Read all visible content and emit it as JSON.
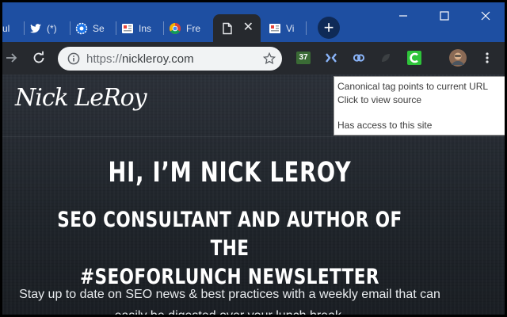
{
  "tabs": [
    {
      "title": "ul",
      "icon": "partial-tab-icon"
    },
    {
      "title": "(*)",
      "icon": "twitter-bird-icon"
    },
    {
      "title": "Se",
      "icon": "gear-badge-icon"
    },
    {
      "title": "Ins",
      "icon": "report-icon"
    },
    {
      "title": "Fre",
      "icon": "chrome-icon"
    },
    {
      "title": "",
      "icon": "document-icon",
      "active": true
    },
    {
      "title": "Vi",
      "icon": "report-icon"
    }
  ],
  "address": {
    "scheme": "https://",
    "host": "nickleroy.com"
  },
  "extensions": {
    "badge_count": "37"
  },
  "site": {
    "logo_text": "Nick LeRoy",
    "heading": "HI, I’M NICK LEROY",
    "subheading_line1": "SEO CONSULTANT AND AUTHOR OF THE",
    "subheading_line2": "#SEOFORLUNCH NEWSLETTER",
    "lede_line1": "Stay up to date on SEO news & best practices with a weekly email that can",
    "lede_line2": "easily be digested over your lunch break."
  },
  "tooltip": {
    "line1": "Canonical tag points to current URL",
    "line2": "Click to view source",
    "line3": "Has access to this site"
  },
  "colors": {
    "tabstrip": "#1e4fa2",
    "toolbar": "#26292e",
    "canonical_ext": "#2ec43a"
  }
}
